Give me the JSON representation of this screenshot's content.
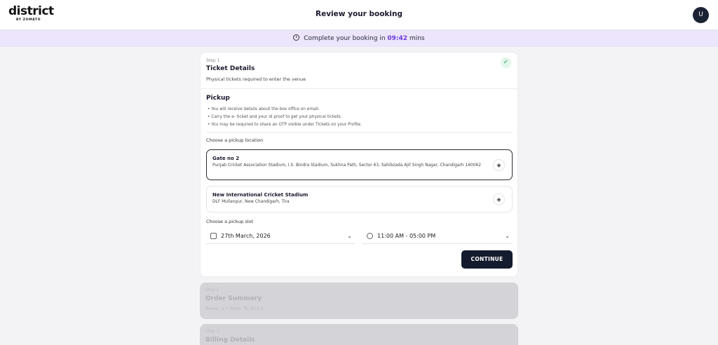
{
  "header": {
    "logo_text": "district",
    "logo_sub": "BY ZOMATO",
    "title": "Review your booking",
    "avatar_initial": "U"
  },
  "timer": {
    "prefix": "Complete your booking in",
    "time": "09:42",
    "suffix": "mins"
  },
  "step1": {
    "step_label": "Step 1",
    "title": "Ticket Details",
    "subtitle": "Physical tickets required to enter the venue",
    "pickup": {
      "title": "Pickup",
      "bullets": [
        "You will receive details about the box office on email.",
        "Carry the e- ticket and your id proof to get your physical tickets.",
        "You may be required to share an OTP visible under Tickets on your Profile."
      ]
    },
    "choose_location_label": "Choose a pickup location",
    "locations": [
      {
        "name": "Gate no 2",
        "address": "Punjab Cricket Association Stadium, I.S. Bindra Stadium, Sukhna Path, Sector 63, Sahibzada Ajit Singh Nagar, Chandigarh 160062",
        "selected": true
      },
      {
        "name": "New International Cricket Stadium",
        "address": "DLF Mullanpur, New Chandigarh, Tira",
        "selected": false
      }
    ],
    "choose_slot_label": "Choose a pickup slot",
    "slot_date": "27th March, 2026",
    "slot_time": "11:00 AM - 05:00 PM",
    "continue_label": "CONTINUE"
  },
  "step2": {
    "step_label": "Step 2",
    "title": "Order Summary",
    "subtitle": "Items: 1 • Total: ₹2,915.5"
  },
  "step3": {
    "step_label": "Step 3",
    "title": "Billing Details"
  },
  "colors": {
    "accent": "#6c3ce0",
    "button": "#141b2e",
    "timer_bg": "#ece5fb",
    "success": "#1f9d55"
  }
}
